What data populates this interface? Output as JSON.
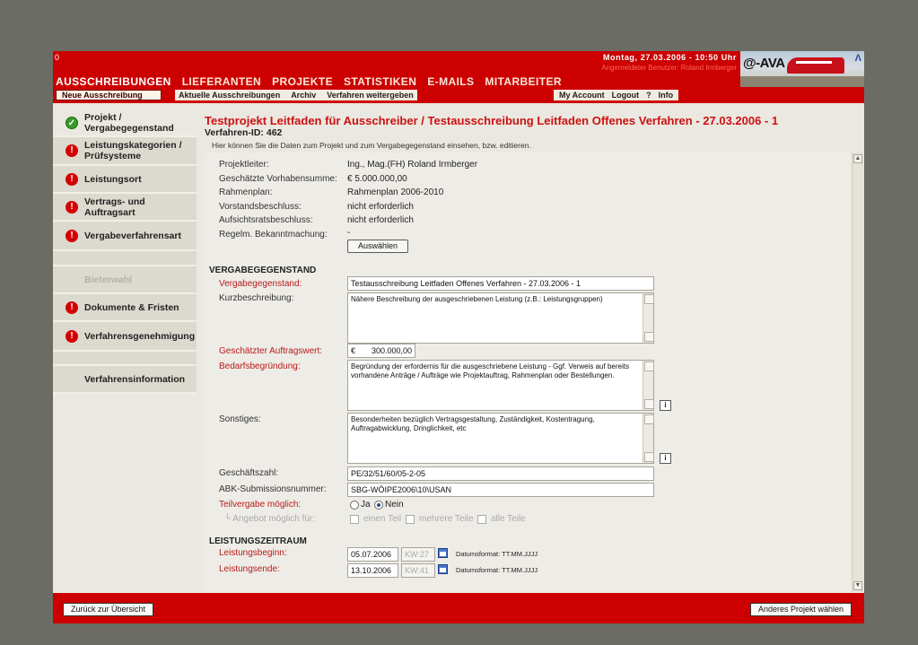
{
  "header": {
    "corner": "0",
    "date": "Montag, 27.03.2006 - 10:50 Uhr",
    "user": "Angemeldeter Benutzer: Roland Irmberger",
    "logo": "@-AVA",
    "nav": [
      "AUSSCHREIBUNGEN",
      "LIEFERANTEN",
      "PROJEKTE",
      "STATISTIKEN",
      "E-MAILS",
      "MITARBEITER"
    ]
  },
  "subnav": {
    "new_button": "Neue Ausschreibung",
    "links": [
      "Aktuelle Ausschreibungen",
      "Archiv",
      "Verfahren weitergeben"
    ],
    "right_links": [
      "My Account",
      "Logout",
      "?",
      "Info"
    ]
  },
  "sidebar": {
    "items": [
      {
        "label": "Projekt / Vergabegegenstand",
        "status": "ok"
      },
      {
        "label": "Leistungskategorien / Prüfsysteme",
        "status": "error"
      },
      {
        "label": "Leistungsort",
        "status": "error"
      },
      {
        "label": "Vertrags- und Auftragsart",
        "status": "error"
      },
      {
        "label": "Vergabeverfahrensart",
        "status": "error"
      },
      {
        "label": "",
        "status": "none"
      },
      {
        "label": "Bieterwahl",
        "status": "disabled"
      },
      {
        "label": "Dokumente & Fristen",
        "status": "error"
      },
      {
        "label": "Verfahrensgenehmigung",
        "status": "error"
      },
      {
        "label": "",
        "status": "none"
      },
      {
        "label": "Verfahrensinformation",
        "status": "none"
      }
    ]
  },
  "main": {
    "title": "Testprojekt Leitfaden für Ausschreiber / Testausschreibung Leitfaden Offenes Verfahren - 27.03.2006 - 1",
    "verfahren_id": "Verfahren-ID: 462",
    "hint": "Hier können Sie die Daten zum Projekt und zum Vergabegegenstand einsehen, bzw. editieren.",
    "project_rows": [
      {
        "label": "Projektleiter:",
        "value": "Ing., Mag.(FH) Roland Irmberger"
      },
      {
        "label": "Geschätzte Vorhabensumme:",
        "value": "€ 5.000.000,00"
      },
      {
        "label": "Rahmenplan:",
        "value": "Rahmenplan 2006-2010"
      },
      {
        "label": "Vorstandsbeschluss:",
        "value": "nicht erforderlich"
      },
      {
        "label": "Aufsichtsratsbeschluss:",
        "value": "nicht erforderlich"
      },
      {
        "label": "Regelm. Bekanntmachung:",
        "value": "-"
      }
    ],
    "select_button": "Auswählen",
    "vergabe": {
      "heading": "VERGABEGEGENSTAND",
      "gegenstand_label": "Vergabegegenstand:",
      "gegenstand_value": "Testausschreibung Leitfaden Offenes Verfahren - 27.03.2006 - 1",
      "kurz_label": "Kurzbeschreibung:",
      "kurz_value": "Nähere Beschreibung der ausgeschriebenen Leistung (z.B.: Leistungsgruppen)",
      "wert_label": "Geschätzter Auftragswert:",
      "wert_currency": "€",
      "wert_value": "300.000,00",
      "bedarf_label": "Bedarfsbegründung:",
      "bedarf_value": "Begründung der erfordernis für die ausgeschriebene Leistung - Ggf. Verweis auf bereits vorhandene Anträge / Aufträge wie Projektauftrag, Rahmenplan oder Bestellungen.",
      "sonst_label": "Sonstiges:",
      "sonst_value": "Besonderheiten bezüglich Vertragsgestaltung, Zuständigkeit, Kostentragung, Auftragabwicklung, Dringlichkeit, etc",
      "info_glyph": "i",
      "gz_label": "Geschäftszahl:",
      "gz_value": "PE/32/51/60/05-2-05",
      "abk_label": "ABK-Submissionsnummer:",
      "abk_value": "SBG-WÖIPE2006\\10\\USAN",
      "teil_label": "Teilvergabe möglich:",
      "teil_ja": "Ja",
      "teil_nein": "Nein",
      "angebot_label": "└ Angebot möglich für:",
      "angebot_opts": [
        "einen Teil",
        "mehrere Teile",
        "alle Teile"
      ]
    },
    "zeitraum": {
      "heading": "LEISTUNGSZEITRAUM",
      "beginn_label": "Leistungsbeginn:",
      "beginn_date": "05.07.2006",
      "beginn_kw": "KW:27",
      "ende_label": "Leistungsende:",
      "ende_date": "13.10.2006",
      "ende_kw": "KW:41",
      "format": "Datumsformat: TT.MM.JJJJ"
    }
  },
  "footer": {
    "back_button": "Zurück zur Übersicht",
    "other_button": "Anderes Projekt wählen"
  }
}
